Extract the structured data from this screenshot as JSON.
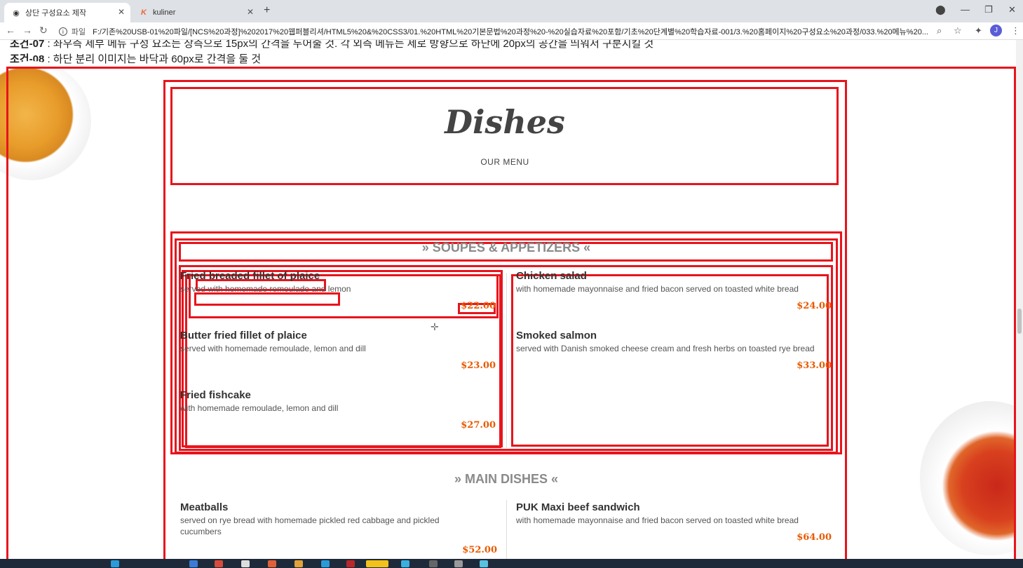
{
  "browser": {
    "tabs": [
      {
        "label": "상단 구성요소 제작",
        "icon": "globe-icon"
      },
      {
        "label": "kuliner",
        "icon": "k-logo-icon"
      }
    ],
    "url_prefix": "파일",
    "url": "F:/기존%20USB-01%20파일/[NCS%20과정]%202017%20웹퍼블리셔/HTML5%20&%20CSS3/01.%20HTML%20기본문법%20과정%20-%20실습자료%20포함/기초%20단계별%20학습자료-001/3.%20홈페이지%20구성요소%20과정/033.%20메뉴%20...",
    "avatar": "J"
  },
  "conditions": [
    {
      "label": "조건-07",
      "text": " : 좌우측 세부 메뉴 구성 요소는 상측으로 15px의 간격을 두어줄 것. 각 외측 메뉴는 세로 방향으로 하단에 20px의 공간을 띄워서 구분시킬 것"
    },
    {
      "label": "조건-08",
      "text": " : 하단 분리 이미지는 바닥과 60px로 간격을 둘 것"
    }
  ],
  "menu": {
    "title": "Dishes",
    "subtitle": "OUR MENU",
    "sections": [
      {
        "heading": "» SOUPES & APPETIZERS «",
        "left": [
          {
            "name": "Fried breaded fillet of plaice",
            "desc": "served with homemade remoulade and lemon",
            "price": "$22.00"
          },
          {
            "name": "Butter fried fillet of plaice",
            "desc": "served with homemade remoulade, lemon and dill",
            "price": "$23.00"
          },
          {
            "name": "Fried fishcake",
            "desc": "with homemade remoulade, lemon and dill",
            "price": "$27.00"
          }
        ],
        "right": [
          {
            "name": "Chicken salad",
            "desc": "with homemade mayonnaise and fried bacon served on toasted white bread",
            "price": "$24.00"
          },
          {
            "name": "Smoked salmon",
            "desc": "served with Danish smoked cheese cream and fresh herbs on toasted rye bread",
            "price": "$33.00"
          }
        ]
      },
      {
        "heading": "» MAIN DISHES «",
        "left": [
          {
            "name": "Meatballs",
            "desc": "served on rye bread with homemade pickled red cabbage and pickled cucumbers",
            "price": "$52.00"
          }
        ],
        "right": [
          {
            "name": "PUK Maxi beef sandwich",
            "desc": "with homemade mayonnaise and fried bacon served on toasted white bread",
            "price": "$64.00"
          }
        ]
      }
    ]
  },
  "colors": {
    "outline": "#e8141c",
    "price": "#e85a00",
    "heading": "#8a8a8a"
  }
}
